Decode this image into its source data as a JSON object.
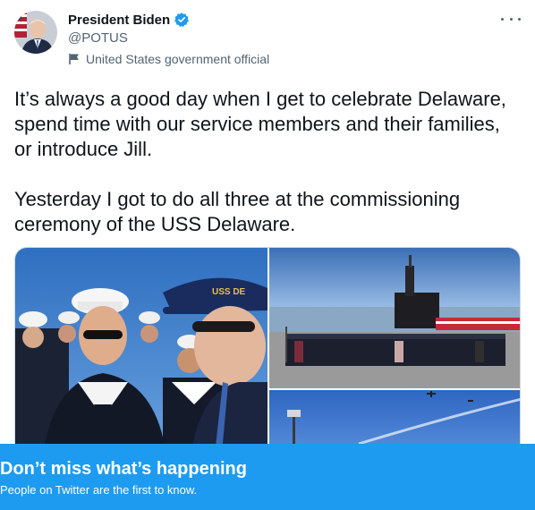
{
  "author": {
    "display_name": "President Biden",
    "handle": "@POTUS",
    "affiliation": "United States government official",
    "verified_icon": "verified-badge-icon"
  },
  "tweet": {
    "paragraph1": "It’s always a good day when I get to celebrate Delaware, spend time with our service members and their families, or introduce Jill.",
    "paragraph2": "Yesterday I got to do all three at the commissioning ceremony of the USS Delaware."
  },
  "media": {
    "photos": [
      "sailors-with-president-photo",
      "submarine-crew-group-photo",
      "sky-flyover-photo"
    ]
  },
  "banner": {
    "title": "Don’t miss what’s happening",
    "subtitle": "People on Twitter are the first to know."
  },
  "colors": {
    "accent": "#1d9bf0",
    "text_primary": "#0f1419",
    "text_secondary": "#536471"
  }
}
